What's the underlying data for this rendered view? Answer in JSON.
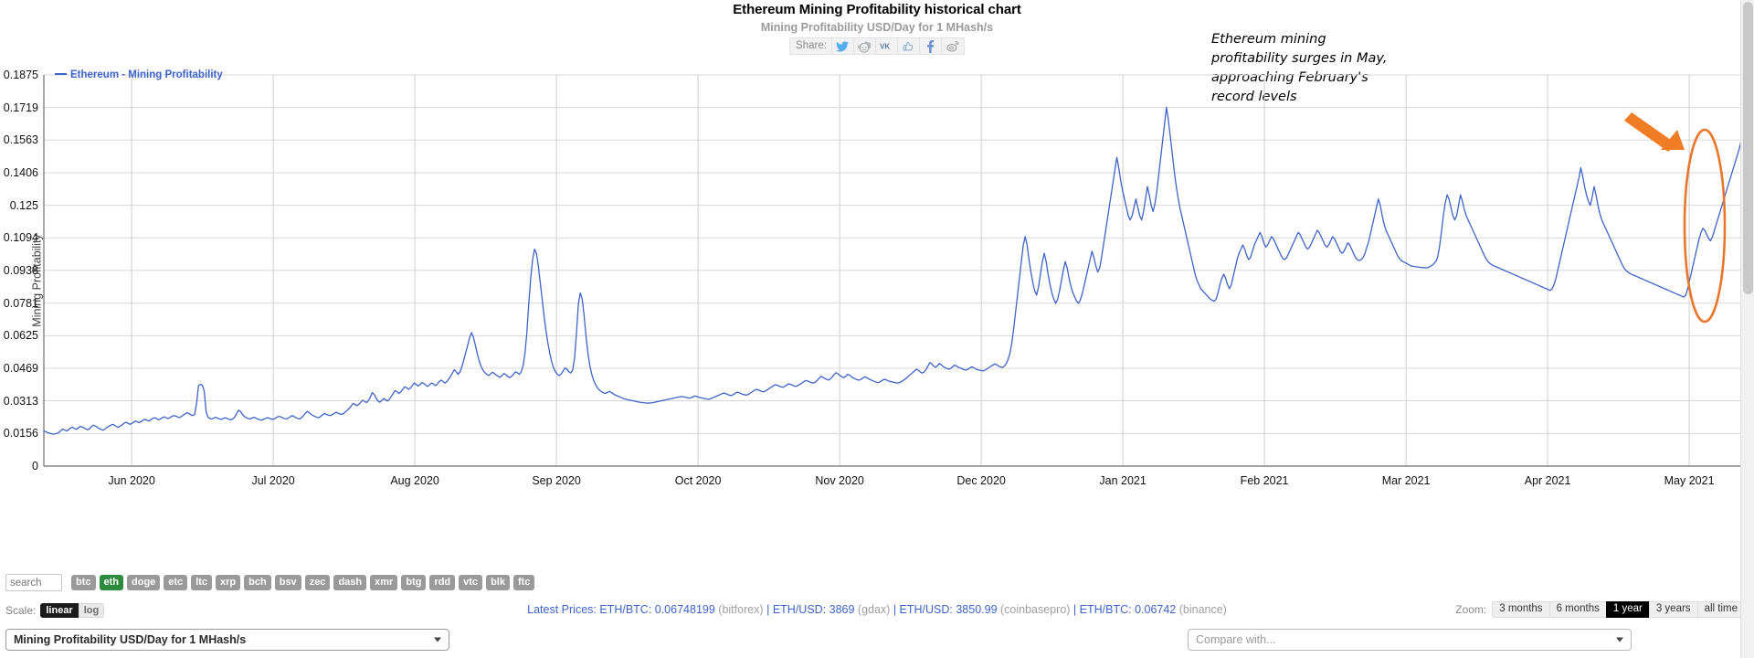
{
  "header": {
    "title": "Ethereum Mining Profitability historical chart",
    "subtitle": "Mining Profitability USD/Day for 1 MHash/s"
  },
  "share": {
    "label": "Share:",
    "buttons": [
      {
        "name": "twitter-icon",
        "title": "Twitter"
      },
      {
        "name": "reddit-icon",
        "title": "Reddit"
      },
      {
        "name": "vk-icon",
        "title": "VK"
      },
      {
        "name": "odnoklassniki-icon",
        "title": "Odnoklassniki"
      },
      {
        "name": "facebook-icon",
        "title": "Facebook"
      },
      {
        "name": "weibo-icon",
        "title": "Weibo"
      }
    ]
  },
  "annotation": {
    "text": "Ethereum mining profitability surges in May, approaching February's record levels",
    "arrow_color": "#f07d25",
    "ellipse_color": "#e8762c"
  },
  "legend": {
    "label": "Ethereum - Mining Profitability",
    "color": "#3e64c8"
  },
  "coins": {
    "search_placeholder": "search",
    "tags": [
      "btc",
      "eth",
      "doge",
      "etc",
      "ltc",
      "xrp",
      "bch",
      "bsv",
      "zec",
      "dash",
      "xmr",
      "btg",
      "rdd",
      "vtc",
      "blk",
      "ftc"
    ],
    "active": "eth",
    "active_color": "#2e8b3d",
    "inactive_color": "#9a9a9a"
  },
  "scale": {
    "label": "Scale:",
    "options": [
      "linear",
      "log"
    ],
    "active": "linear"
  },
  "prices": {
    "label": "Latest Prices:",
    "items": [
      {
        "pair": "ETH/BTC:",
        "value": "0.06748199",
        "exchange": "(bitforex)"
      },
      {
        "pair": "ETH/USD:",
        "value": "3869",
        "exchange": "(gdax)"
      },
      {
        "pair": "ETH/USD:",
        "value": "3850.99",
        "exchange": "(coinbasepro)"
      },
      {
        "pair": "ETH/BTC:",
        "value": "0.06742",
        "exchange": "(binance)"
      }
    ],
    "separator": "|"
  },
  "zoom": {
    "label": "Zoom:",
    "options": [
      "3 months",
      "6 months",
      "1 year",
      "3 years",
      "all time"
    ],
    "active": "1 year"
  },
  "selects": {
    "metric": "Mining Profitability USD/Day for 1 MHash/s",
    "compare_placeholder": "Compare with..."
  },
  "chart_data": {
    "type": "line",
    "title": "Ethereum Mining Profitability historical chart",
    "subtitle": "Mining Profitability USD/Day for 1 MHash/s",
    "xlabel": "",
    "ylabel": "Mining Profitability",
    "grid": true,
    "legend_position": "top-left",
    "ylim": [
      0,
      0.1875
    ],
    "yticks": [
      0.1875,
      0.1719,
      0.1563,
      0.1406,
      0.125,
      0.1094,
      0.0938,
      0.0781,
      0.0625,
      0.0469,
      0.0313,
      0.0156,
      0
    ],
    "ytick_labels": [
      "0.1875",
      "0.1719",
      "0.1563",
      "0.1406",
      "0.125",
      "0.1094",
      "0.0938",
      "0.0781",
      "0.0625",
      "0.0469",
      "0.0313",
      "0.0156",
      "0"
    ],
    "xticks": [
      "Jun 2020",
      "Jul 2020",
      "Aug 2020",
      "Sep 2020",
      "Oct 2020",
      "Nov 2020",
      "Dec 2020",
      "Jan 2021",
      "Feb 2021",
      "Mar 2021",
      "Apr 2021",
      "May 2021"
    ],
    "series": [
      {
        "name": "Ethereum - Mining Profitability",
        "color": "#3e64c8",
        "values": [
          0.0168,
          0.0165,
          0.016,
          0.0158,
          0.0155,
          0.0153,
          0.0155,
          0.0158,
          0.0162,
          0.017,
          0.0178,
          0.0172,
          0.0168,
          0.0175,
          0.0183,
          0.0186,
          0.018,
          0.0176,
          0.0182,
          0.019,
          0.0188,
          0.0183,
          0.0178,
          0.0174,
          0.018,
          0.019,
          0.0196,
          0.0192,
          0.0186,
          0.018,
          0.0176,
          0.0172,
          0.0178,
          0.0185,
          0.019,
          0.0195,
          0.02,
          0.0196,
          0.019,
          0.0186,
          0.0192,
          0.0198,
          0.0205,
          0.021,
          0.0206,
          0.02,
          0.0204,
          0.021,
          0.0216,
          0.0212,
          0.0208,
          0.0214,
          0.022,
          0.0224,
          0.022,
          0.0216,
          0.0222,
          0.0228,
          0.0232,
          0.0228,
          0.0222,
          0.0226,
          0.0232,
          0.0236,
          0.0232,
          0.0228,
          0.0232,
          0.0238,
          0.0242,
          0.024,
          0.0236,
          0.0232,
          0.0238,
          0.0244,
          0.025,
          0.0256,
          0.0252,
          0.0246,
          0.0242,
          0.0248,
          0.03,
          0.0386,
          0.0392,
          0.0388,
          0.036,
          0.026,
          0.0234,
          0.0228,
          0.0226,
          0.023,
          0.0234,
          0.023,
          0.0226,
          0.0224,
          0.0228,
          0.0232,
          0.0228,
          0.0224,
          0.0222,
          0.0226,
          0.0236,
          0.0252,
          0.0268,
          0.0262,
          0.0248,
          0.0238,
          0.0232,
          0.0228,
          0.0226,
          0.023,
          0.0234,
          0.023,
          0.0226,
          0.0222,
          0.022,
          0.0224,
          0.0228,
          0.0232,
          0.023,
          0.0226,
          0.0224,
          0.0228,
          0.0234,
          0.0238,
          0.0236,
          0.0232,
          0.0228,
          0.0226,
          0.023,
          0.0236,
          0.0242,
          0.0238,
          0.0232,
          0.0228,
          0.0226,
          0.0232,
          0.0242,
          0.0254,
          0.0262,
          0.0256,
          0.0248,
          0.0242,
          0.0238,
          0.0234,
          0.0232,
          0.0238,
          0.0246,
          0.0252,
          0.0248,
          0.0244,
          0.0242,
          0.0246,
          0.0252,
          0.0258,
          0.0254,
          0.025,
          0.0248,
          0.0252,
          0.026,
          0.0268,
          0.0278,
          0.0288,
          0.03,
          0.0296,
          0.029,
          0.0296,
          0.0306,
          0.0316,
          0.031,
          0.0304,
          0.0314,
          0.033,
          0.0352,
          0.0344,
          0.0326,
          0.0312,
          0.0306,
          0.0314,
          0.0324,
          0.0318,
          0.0312,
          0.032,
          0.0334,
          0.0348,
          0.0362,
          0.0356,
          0.0348,
          0.0356,
          0.0368,
          0.038,
          0.0376,
          0.0368,
          0.0374,
          0.0386,
          0.0398,
          0.0392,
          0.0384,
          0.039,
          0.04,
          0.0396,
          0.0388,
          0.0382,
          0.039,
          0.0398,
          0.0394,
          0.0386,
          0.0392,
          0.0404,
          0.0412,
          0.0406,
          0.0398,
          0.0404,
          0.0416,
          0.043,
          0.0446,
          0.0462,
          0.0452,
          0.044,
          0.0452,
          0.0478,
          0.051,
          0.0545,
          0.058,
          0.0615,
          0.064,
          0.0618,
          0.058,
          0.054,
          0.0505,
          0.0478,
          0.046,
          0.0448,
          0.044,
          0.0434,
          0.0442,
          0.045,
          0.0444,
          0.0436,
          0.043,
          0.0426,
          0.0434,
          0.0444,
          0.0438,
          0.043,
          0.0424,
          0.043,
          0.044,
          0.0452,
          0.0448,
          0.044,
          0.045,
          0.048,
          0.054,
          0.064,
          0.078,
          0.09,
          0.099,
          0.104,
          0.102,
          0.096,
          0.088,
          0.08,
          0.072,
          0.065,
          0.059,
          0.054,
          0.05,
          0.047,
          0.0452,
          0.044,
          0.0434,
          0.0442,
          0.0456,
          0.047,
          0.0464,
          0.0452,
          0.0446,
          0.046,
          0.052,
          0.064,
          0.078,
          0.083,
          0.08,
          0.072,
          0.062,
          0.054,
          0.048,
          0.044,
          0.041,
          0.039,
          0.0375,
          0.0365,
          0.0358,
          0.0352,
          0.0348,
          0.0352,
          0.0358,
          0.0354,
          0.0348,
          0.0342,
          0.0338,
          0.0334,
          0.033,
          0.0326,
          0.0322,
          0.032,
          0.0318,
          0.0316,
          0.0314,
          0.0312,
          0.031,
          0.0308,
          0.0306,
          0.0305,
          0.0304,
          0.0303,
          0.0302,
          0.0302,
          0.0303,
          0.0304,
          0.0306,
          0.0308,
          0.031,
          0.0312,
          0.0314,
          0.0316,
          0.0318,
          0.032,
          0.0322,
          0.0324,
          0.0326,
          0.0328,
          0.033,
          0.0332,
          0.0334,
          0.0332,
          0.033,
          0.0328,
          0.0326,
          0.0328,
          0.0332,
          0.0336,
          0.0334,
          0.033,
          0.0328,
          0.0326,
          0.0324,
          0.0322,
          0.032,
          0.0322,
          0.0326,
          0.033,
          0.0334,
          0.0338,
          0.0342,
          0.0346,
          0.035,
          0.0348,
          0.0344,
          0.034,
          0.0338,
          0.0342,
          0.0348,
          0.0354,
          0.0352,
          0.0348,
          0.0344,
          0.0342,
          0.034,
          0.0344,
          0.035,
          0.0356,
          0.0362,
          0.0368,
          0.0366,
          0.0362,
          0.0358,
          0.0356,
          0.036,
          0.0366,
          0.0372,
          0.0378,
          0.0384,
          0.039,
          0.0388,
          0.0384,
          0.038,
          0.0378,
          0.0382,
          0.0388,
          0.0394,
          0.0392,
          0.0388,
          0.0384,
          0.0382,
          0.0386,
          0.0392,
          0.0398,
          0.0404,
          0.041,
          0.0408,
          0.0404,
          0.04,
          0.0398,
          0.0402,
          0.041,
          0.042,
          0.043,
          0.0426,
          0.042,
          0.0416,
          0.0412,
          0.0418,
          0.0428,
          0.044,
          0.0448,
          0.0442,
          0.0434,
          0.0428,
          0.0424,
          0.043,
          0.044,
          0.0436,
          0.0428,
          0.0422,
          0.0418,
          0.0414,
          0.0412,
          0.0416,
          0.0422,
          0.0428,
          0.0424,
          0.0418,
          0.0414,
          0.041,
          0.0406,
          0.0402,
          0.04,
          0.0404,
          0.041,
          0.0416,
          0.0414,
          0.041,
          0.0406,
          0.0404,
          0.0402,
          0.04,
          0.0398,
          0.04,
          0.0404,
          0.041,
          0.0416,
          0.0424,
          0.0432,
          0.044,
          0.0448,
          0.0456,
          0.0464,
          0.046,
          0.0452,
          0.0446,
          0.045,
          0.0462,
          0.0478,
          0.0496,
          0.049,
          0.048,
          0.0474,
          0.048,
          0.0492,
          0.0486,
          0.0478,
          0.0472,
          0.0468,
          0.0464,
          0.0468,
          0.0476,
          0.0484,
          0.048,
          0.0474,
          0.047,
          0.0466,
          0.0462,
          0.046,
          0.0464,
          0.047,
          0.0476,
          0.0472,
          0.0466,
          0.0462,
          0.046,
          0.0458,
          0.0456,
          0.046,
          0.0466,
          0.0472,
          0.0478,
          0.0484,
          0.049,
          0.0486,
          0.048,
          0.0476,
          0.0472,
          0.0478,
          0.049,
          0.051,
          0.054,
          0.059,
          0.066,
          0.074,
          0.082,
          0.09,
          0.098,
          0.106,
          0.11,
          0.106,
          0.099,
          0.093,
          0.088,
          0.084,
          0.082,
          0.086,
          0.092,
          0.098,
          0.102,
          0.098,
          0.092,
          0.087,
          0.083,
          0.08,
          0.078,
          0.08,
          0.084,
          0.089,
          0.094,
          0.098,
          0.095,
          0.09,
          0.086,
          0.083,
          0.081,
          0.079,
          0.078,
          0.08,
          0.083,
          0.087,
          0.091,
          0.095,
          0.099,
          0.103,
          0.1,
          0.096,
          0.093,
          0.095,
          0.1,
          0.106,
          0.112,
          0.118,
          0.124,
          0.13,
          0.136,
          0.142,
          0.148,
          0.143,
          0.137,
          0.132,
          0.128,
          0.124,
          0.12,
          0.118,
          0.12,
          0.124,
          0.128,
          0.124,
          0.12,
          0.118,
          0.122,
          0.128,
          0.134,
          0.13,
          0.125,
          0.122,
          0.126,
          0.132,
          0.14,
          0.148,
          0.156,
          0.164,
          0.172,
          0.166,
          0.158,
          0.15,
          0.142,
          0.135,
          0.129,
          0.124,
          0.12,
          0.116,
          0.112,
          0.108,
          0.104,
          0.1,
          0.096,
          0.092,
          0.089,
          0.087,
          0.085,
          0.084,
          0.083,
          0.082,
          0.081,
          0.08,
          0.0795,
          0.079,
          0.08,
          0.083,
          0.087,
          0.09,
          0.092,
          0.09,
          0.087,
          0.085,
          0.087,
          0.091,
          0.095,
          0.099,
          0.102,
          0.104,
          0.106,
          0.104,
          0.101,
          0.099,
          0.1,
          0.103,
          0.106,
          0.108,
          0.11,
          0.112,
          0.11,
          0.107,
          0.105,
          0.106,
          0.108,
          0.11,
          0.109,
          0.107,
          0.105,
          0.103,
          0.101,
          0.0995,
          0.099,
          0.1,
          0.102,
          0.104,
          0.106,
          0.108,
          0.11,
          0.112,
          0.111,
          0.109,
          0.107,
          0.105,
          0.104,
          0.105,
          0.107,
          0.109,
          0.111,
          0.113,
          0.112,
          0.11,
          0.108,
          0.106,
          0.105,
          0.106,
          0.108,
          0.11,
          0.109,
          0.107,
          0.105,
          0.103,
          0.102,
          0.103,
          0.105,
          0.107,
          0.106,
          0.104,
          0.102,
          0.1,
          0.099,
          0.0985,
          0.099,
          0.1,
          0.102,
          0.105,
          0.108,
          0.112,
          0.116,
          0.12,
          0.124,
          0.128,
          0.125,
          0.12,
          0.116,
          0.113,
          0.111,
          0.109,
          0.107,
          0.105,
          0.103,
          0.101,
          0.0995,
          0.0985,
          0.098,
          0.0975,
          0.097,
          0.0965,
          0.096,
          0.0958,
          0.0956,
          0.0955,
          0.0954,
          0.0953,
          0.0952,
          0.0951,
          0.095,
          0.0952,
          0.0956,
          0.0962,
          0.097,
          0.098,
          0.1,
          0.105,
          0.112,
          0.12,
          0.126,
          0.13,
          0.128,
          0.124,
          0.12,
          0.118,
          0.12,
          0.125,
          0.13,
          0.127,
          0.123,
          0.12,
          0.118,
          0.116,
          0.114,
          0.112,
          0.11,
          0.108,
          0.106,
          0.104,
          0.102,
          0.1,
          0.0985,
          0.0975,
          0.0968,
          0.0962,
          0.0958,
          0.0954,
          0.095,
          0.0946,
          0.0942,
          0.0938,
          0.0934,
          0.093,
          0.0926,
          0.0922,
          0.0918,
          0.0914,
          0.091,
          0.0906,
          0.0902,
          0.0898,
          0.0894,
          0.089,
          0.0886,
          0.0882,
          0.0878,
          0.0874,
          0.087,
          0.0866,
          0.0862,
          0.0858,
          0.0854,
          0.085,
          0.0846,
          0.0842,
          0.085,
          0.087,
          0.09,
          0.094,
          0.098,
          0.102,
          0.106,
          0.11,
          0.114,
          0.118,
          0.122,
          0.126,
          0.13,
          0.134,
          0.138,
          0.143,
          0.139,
          0.134,
          0.13,
          0.127,
          0.125,
          0.129,
          0.134,
          0.13,
          0.125,
          0.121,
          0.118,
          0.116,
          0.114,
          0.112,
          0.11,
          0.108,
          0.106,
          0.104,
          0.102,
          0.1,
          0.098,
          0.096,
          0.0945,
          0.0935,
          0.0928,
          0.0922,
          0.0918,
          0.0914,
          0.091,
          0.0906,
          0.0902,
          0.0898,
          0.0894,
          0.089,
          0.0886,
          0.0882,
          0.0878,
          0.0874,
          0.087,
          0.0866,
          0.0862,
          0.0858,
          0.0854,
          0.085,
          0.0846,
          0.0842,
          0.0838,
          0.0834,
          0.083,
          0.0826,
          0.0822,
          0.0818,
          0.0814,
          0.081,
          0.082,
          0.085,
          0.089,
          0.093,
          0.097,
          0.101,
          0.105,
          0.109,
          0.112,
          0.114,
          0.113,
          0.111,
          0.109,
          0.108,
          0.11,
          0.113,
          0.116,
          0.119,
          0.122,
          0.125,
          0.128,
          0.131,
          0.134,
          0.137,
          0.14,
          0.143,
          0.146,
          0.149,
          0.152,
          0.156,
          0.16
        ]
      }
    ],
    "annotation": {
      "text": "Ethereum mining profitability surges in May, approaching February's record levels",
      "highlight_region": "May 2021",
      "highlight_shape": "ellipse"
    }
  }
}
